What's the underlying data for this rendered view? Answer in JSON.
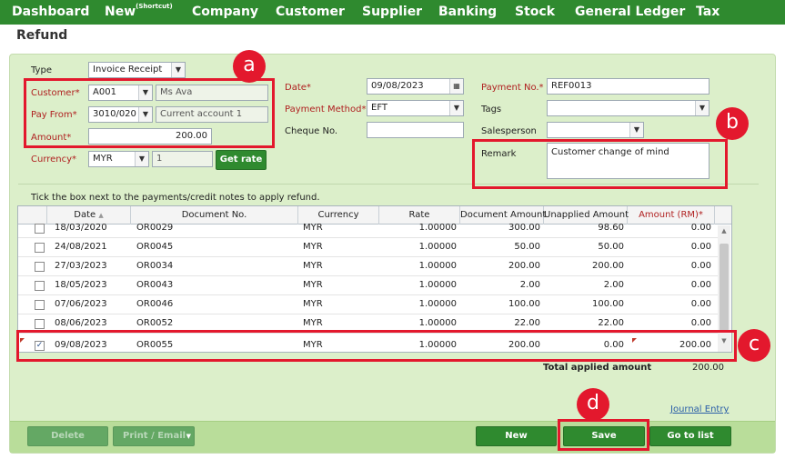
{
  "nav": {
    "items": [
      "Dashboard",
      "New",
      "Company",
      "Customer",
      "Supplier",
      "Banking",
      "Stock",
      "General Ledger",
      "Tax"
    ],
    "new_sup": "(Shortcut)"
  },
  "page_title": "Refund",
  "form": {
    "type_label": "Type",
    "type_value": "Invoice Receipt",
    "customer_label": "Customer*",
    "customer_code": "A001",
    "customer_name": "Ms Ava",
    "payfrom_label": "Pay From*",
    "payfrom_code": "3010/020",
    "payfrom_name": "Current account 1",
    "amount_label": "Amount*",
    "amount_value": "200.00",
    "currency_label": "Currency*",
    "currency_value": "MYR",
    "rate_value": "1",
    "get_rate": "Get rate",
    "date_label": "Date*",
    "date_value": "09/08/2023",
    "paymethod_label": "Payment Method*",
    "paymethod_value": "EFT",
    "cheque_label": "Cheque No.",
    "cheque_value": "",
    "payno_label": "Payment No.*",
    "payno_value": "REF0013",
    "tags_label": "Tags",
    "salesperson_label": "Salesperson",
    "remark_label": "Remark",
    "remark_value": "Customer change of mind"
  },
  "instructions": "Tick the box next to the payments/credit notes to apply refund.",
  "table": {
    "headers": [
      "Date",
      "Document No.",
      "Currency",
      "Rate",
      "Document Amount",
      "Unapplied Amount",
      "Amount (RM)*"
    ],
    "rows": [
      {
        "date": "18/03/2020",
        "doc": "OR0029",
        "currency": "MYR",
        "rate": "1.00000",
        "doc_amt": "300.00",
        "unapplied": "98.60",
        "amount": "0.00",
        "checked": false
      },
      {
        "date": "24/08/2021",
        "doc": "OR0045",
        "currency": "MYR",
        "rate": "1.00000",
        "doc_amt": "50.00",
        "unapplied": "50.00",
        "amount": "0.00",
        "checked": false
      },
      {
        "date": "27/03/2023",
        "doc": "OR0034",
        "currency": "MYR",
        "rate": "1.00000",
        "doc_amt": "200.00",
        "unapplied": "200.00",
        "amount": "0.00",
        "checked": false
      },
      {
        "date": "18/05/2023",
        "doc": "OR0043",
        "currency": "MYR",
        "rate": "1.00000",
        "doc_amt": "2.00",
        "unapplied": "2.00",
        "amount": "0.00",
        "checked": false
      },
      {
        "date": "07/06/2023",
        "doc": "OR0046",
        "currency": "MYR",
        "rate": "1.00000",
        "doc_amt": "100.00",
        "unapplied": "100.00",
        "amount": "0.00",
        "checked": false
      },
      {
        "date": "08/06/2023",
        "doc": "OR0052",
        "currency": "MYR",
        "rate": "1.00000",
        "doc_amt": "22.00",
        "unapplied": "22.00",
        "amount": "0.00",
        "checked": false
      },
      {
        "date": "09/08/2023",
        "doc": "OR0055",
        "currency": "MYR",
        "rate": "1.00000",
        "doc_amt": "200.00",
        "unapplied": "0.00",
        "amount": "200.00",
        "checked": true
      }
    ],
    "total_label": "Total applied amount",
    "total_value": "200.00"
  },
  "journal_entry": "Journal Entry",
  "footer": {
    "delete": "Delete",
    "print_email": "Print / Email",
    "new": "New",
    "save": "Save",
    "goto_list": "Go to list"
  },
  "annotations": [
    "a",
    "b",
    "c",
    "d"
  ],
  "colors": {
    "nav_green": "#2f8a2f",
    "panel_green": "#dcefca",
    "annotation_red": "#e3182d"
  }
}
